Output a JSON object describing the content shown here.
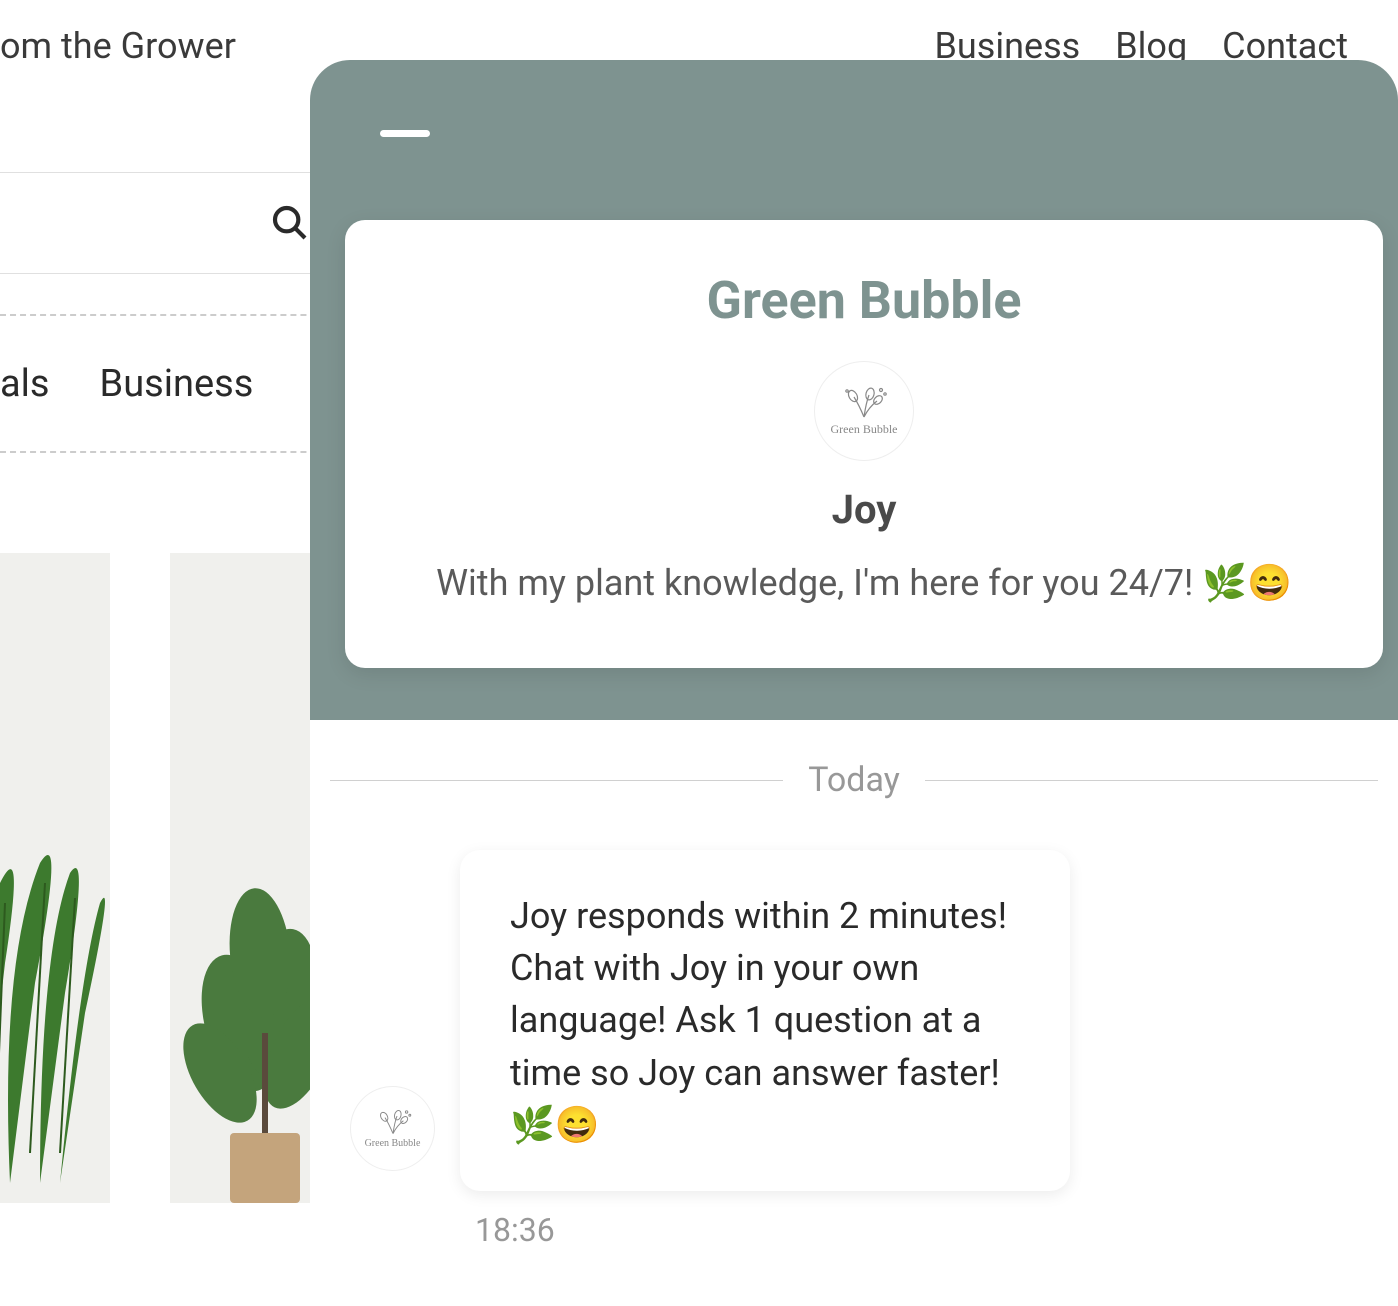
{
  "header": {
    "tagline": "om the Grower",
    "nav": [
      "Business",
      "Blog",
      "Contact"
    ]
  },
  "categories": [
    "als",
    "Business"
  ],
  "chat": {
    "brand": "Green Bubble",
    "avatar_text": "Green Bubble",
    "agent_name": "Joy",
    "agent_tagline": "With my plant knowledge, I'm here for you 24/7! 🌿😄",
    "date_label": "Today",
    "messages": [
      {
        "text": "Joy responds within 2 minutes! Chat with Joy in your own language! Ask 1 question at a time so Joy can answer faster! 🌿😄",
        "time": "18:36"
      }
    ]
  }
}
